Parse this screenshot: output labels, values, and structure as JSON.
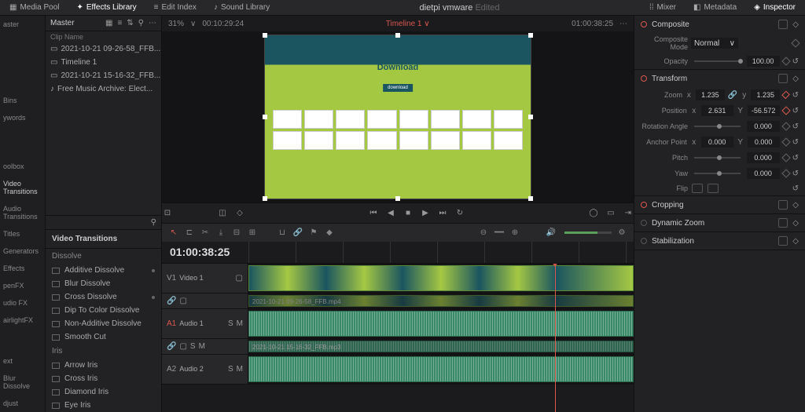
{
  "topbar": {
    "mediapool": "Media Pool",
    "fxlib": "Effects Library",
    "editindex": "Edit Index",
    "soundlib": "Sound Library",
    "project": "dietpi vmware",
    "edited": "Edited",
    "mixer": "Mixer",
    "metadata": "Metadata",
    "inspector": "Inspector"
  },
  "clips": {
    "header": "Master",
    "col": "Clip Name",
    "items": [
      "2021-10-21 09-26-58_FFB...",
      "Timeline 1",
      "2021-10-21 15-16-32_FFB...",
      "Free Music Archive: Elect..."
    ],
    "zoom": "31%",
    "dur": "00:10:29:24"
  },
  "leftlabels": {
    "master": "aster",
    "bins": "Bins",
    "keywords": "ywords",
    "toolbox": "oolbox",
    "videotrans": "Video Transitions",
    "audiotrans": "Audio Transitions",
    "titles": "Titles",
    "generators": "Generators",
    "effects": "Effects",
    "openfx": "penFX",
    "audiofx": "udio FX",
    "fairlightfx": "airlightFX",
    "text": "ext",
    "blurdissolve": "Blur Dissolve",
    "adjust": "djust"
  },
  "transitions": {
    "header": "Video Transitions",
    "cat1": "Dissolve",
    "items1": [
      "Additive Dissolve",
      "Blur Dissolve",
      "Cross Dissolve",
      "Dip To Color Dissolve",
      "Non-Additive Dissolve",
      "Smooth Cut"
    ],
    "cat2": "Iris",
    "items2": [
      "Arrow Iris",
      "Cross Iris",
      "Diamond Iris",
      "Eye Iris"
    ]
  },
  "viewer": {
    "timeline_tab": "Timeline 1",
    "end_tc": "01:00:38:25",
    "preview_title": "Download"
  },
  "inspector": {
    "composite": {
      "title": "Composite",
      "mode_label": "Composite Mode",
      "mode_val": "Normal",
      "opacity_label": "Opacity",
      "opacity_val": "100.00"
    },
    "transform": {
      "title": "Transform",
      "zoom_label": "Zoom",
      "zoom_x": "1.235",
      "zoom_y": "1.235",
      "pos_label": "Position",
      "pos_x": "2.631",
      "pos_y": "-56.572",
      "rot_label": "Rotation Angle",
      "rot_val": "0.000",
      "anchor_label": "Anchor Point",
      "anchor_x": "0.000",
      "anchor_y": "0.000",
      "pitch_label": "Pitch",
      "pitch_val": "0.000",
      "yaw_label": "Yaw",
      "yaw_val": "0.000",
      "flip_label": "Flip"
    },
    "cropping": "Cropping",
    "dynzoom": "Dynamic Zoom",
    "stab": "Stabilization"
  },
  "timeline": {
    "tc": "01:00:38:25",
    "v1_head": "V1",
    "v1_name": "Video 1",
    "clip_v_name": "2021-10-21 09-26-58_FFB.mp4",
    "a1_head": "A1",
    "a1_name": "Audio 1",
    "clip_a_name": "2021-10-21 15-16-32_FFB.mp3",
    "a2_head": "A2",
    "a2_name": "Audio 2"
  }
}
